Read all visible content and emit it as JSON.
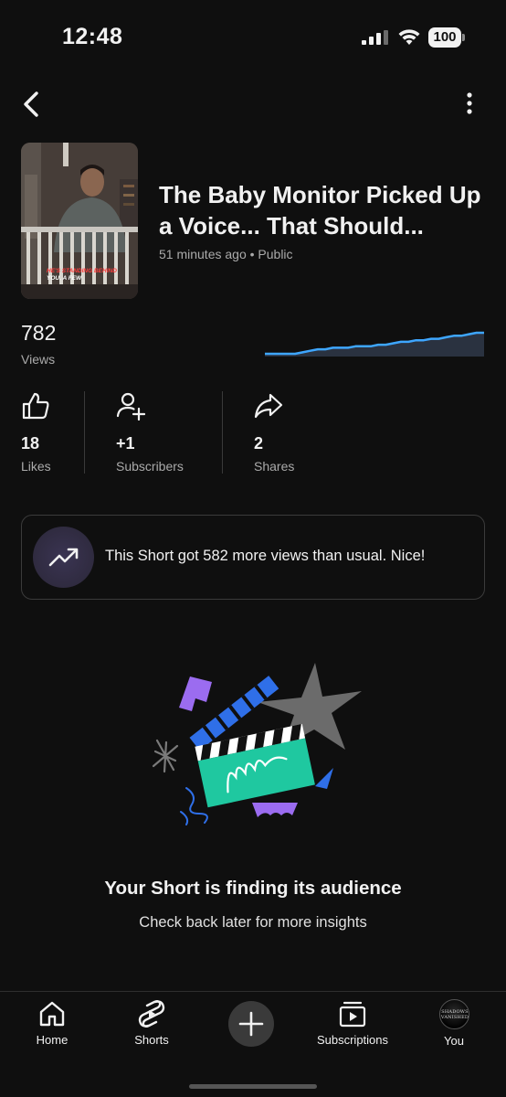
{
  "status_bar": {
    "time": "12:48",
    "battery": "100"
  },
  "header": {
    "back_icon": "chevron-left-icon",
    "menu_icon": "more-vertical-icon"
  },
  "video": {
    "title": "The Baby Monitor Picked Up a Voice... That Should...",
    "meta": "51 minutes ago • Public",
    "thumbnail_caption_highlight": "HE'S STANDING BEHIND",
    "thumbnail_caption_rest": "YOU. A FEW"
  },
  "views": {
    "value": "782",
    "label": "Views",
    "spark_color": "#3ea6ff",
    "spark_values": [
      0,
      0,
      0,
      0,
      0,
      1,
      2,
      3,
      3,
      4,
      4,
      4,
      5,
      5,
      5,
      6,
      6,
      7,
      8,
      8,
      9,
      9,
      10,
      10,
      11,
      12,
      12,
      13,
      14,
      14
    ]
  },
  "stats": [
    {
      "icon": "thumbs-up-icon",
      "value": "18",
      "label": "Likes"
    },
    {
      "icon": "add-person-icon",
      "value": "+1",
      "label": "Subscribers"
    },
    {
      "icon": "share-icon",
      "value": "2",
      "label": "Shares"
    }
  ],
  "insight": {
    "icon": "trending-up-icon",
    "text": "This Short got 582 more views than usual. Nice!"
  },
  "empty_state": {
    "title": "Your Short is finding its audience",
    "subtitle": "Check back later for more insights",
    "illustration": "clapperboard-confetti-illustration"
  },
  "bottom_nav": {
    "items": [
      {
        "icon": "home-icon",
        "label": "Home"
      },
      {
        "icon": "shorts-icon",
        "label": "Shorts"
      },
      {
        "icon": "plus-icon",
        "label": ""
      },
      {
        "icon": "subscriptions-icon",
        "label": "Subscriptions"
      },
      {
        "icon": "avatar",
        "label": "You"
      }
    ],
    "avatar_text_1": "SHADOWS",
    "avatar_text_2": "VANISHED"
  },
  "colors": {
    "background": "#0f0f0f",
    "accent_blue": "#3ea6ff",
    "secondary_text": "#aaaaaa"
  }
}
